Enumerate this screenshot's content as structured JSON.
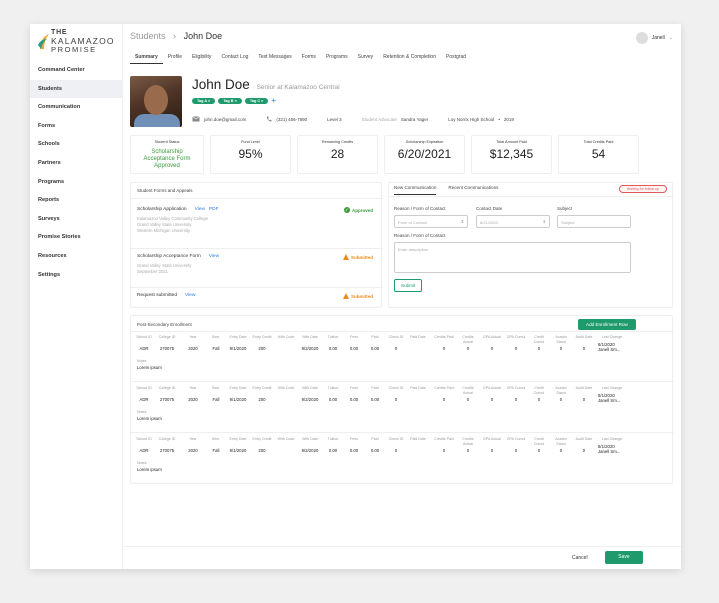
{
  "logo": {
    "line1": "THE",
    "line2": "KALAMAZOO",
    "line3": "PROMISE"
  },
  "sidebar": {
    "items": [
      {
        "label": "Command Center"
      },
      {
        "label": "Students"
      },
      {
        "label": "Communication"
      },
      {
        "label": "Forms"
      },
      {
        "label": "Schools"
      },
      {
        "label": "Partners"
      },
      {
        "label": "Programs"
      },
      {
        "label": "Reports"
      },
      {
        "label": "Surveys"
      },
      {
        "label": "Promise Stories"
      },
      {
        "label": "Resources"
      },
      {
        "label": "Settings"
      }
    ],
    "active": "Students"
  },
  "header": {
    "section": "Students",
    "separator": "›",
    "student": "John Doe",
    "user": "Janell"
  },
  "tabs": [
    "Summary",
    "Profile",
    "Eligibility",
    "Contact Log",
    "Text Messages",
    "Forms",
    "Programs",
    "Survey",
    "Retention & Completion",
    "Postgrad"
  ],
  "student": {
    "name": "John Doe",
    "subtitle": "Senior at Kalamazoo Central",
    "tags": [
      "Tag A",
      "Tag B",
      "Tag C"
    ],
    "email": "john.doe@gmail.com",
    "phone": "(321) 456-7890",
    "level": "Level 3",
    "advocate_label": "Student Advocate",
    "advocate": "Sandra Yager",
    "school": "Loy Norrix High School",
    "year": "2019"
  },
  "stats": {
    "status_label": "Student Status",
    "status_value": "Scholarship Acceptance Form Approved",
    "fund_label": "Fund Level",
    "fund_value": "95%",
    "credits_label": "Remaining Credits",
    "credits_value": "28",
    "expiration_label": "Scholarship Expiration",
    "expiration_value": "6/20/2021",
    "paid_label": "Total Amount Paid",
    "paid_value": "$12,345",
    "tcp_label": "Total Credits Paid",
    "tcp_value": "54"
  },
  "forms": {
    "title": "Student Forms and Appeals",
    "items": [
      {
        "name": "Scholarship Application",
        "view": "View",
        "pdf": "PDF",
        "status": "Approved",
        "sub": [
          "Kalamazoo Valley Community College",
          "Grand Valley State University",
          "Western Michigan University"
        ]
      },
      {
        "name": "Scholarship Acceptance Form",
        "view": "View",
        "status": "Submitted",
        "sub": [
          "Grand Valley State University",
          "September 2021"
        ]
      },
      {
        "name": "Request submitted",
        "view": "View",
        "status": "Submitted"
      }
    ]
  },
  "communication": {
    "tab_new": "New Communication",
    "tab_recent": "Recent Communications",
    "badge": "Waiting for follow up",
    "reason_label": "Reason / Form of Contact",
    "reason_placeholder": "Form of Contact",
    "date_label": "Contact Date",
    "date_value": "6/21/2020",
    "subject_label": "Subject",
    "subject_placeholder": "Subject",
    "desc_label": "Reason / Form of Contact",
    "desc_placeholder": "Enter description",
    "submit": "Submit"
  },
  "enrollment": {
    "title": "Post-Secondary Enrollment",
    "add_button": "Add Enrollment Row",
    "headers": [
      "School ID",
      "College ID",
      "Year",
      "Sem.",
      "Entry Date",
      "Entry Credit",
      "With Code",
      "With Date",
      "Tuition",
      "Fees",
      "Paid",
      "Check ID",
      "Paid Date",
      "Credits Paid",
      "Credits Actual",
      "GPA Actual",
      "GPA Cumul",
      "Credit Cumul",
      "Acadm Stand",
      "Audit Date",
      "Last Change"
    ],
    "rows": [
      {
        "values": [
          "ADR",
          "270075",
          "2020",
          "Fall",
          "9/1/2020",
          "200",
          "",
          "9/2/2020",
          "0.00",
          "0.00",
          "0.00",
          "0",
          "",
          "0",
          "0",
          "0",
          "0",
          "0",
          "0",
          "0",
          "8/1/2020 Janell Sm..."
        ],
        "notes_label": "Notes",
        "notes": "Lorem ipsum"
      },
      {
        "values": [
          "ADR",
          "270075",
          "2020",
          "Fall",
          "9/1/2020",
          "200",
          "",
          "9/2/2020",
          "0.00",
          "0.00",
          "0.00",
          "0",
          "",
          "0",
          "0",
          "0",
          "0",
          "0",
          "0",
          "0",
          "8/1/2020 Janell Sm..."
        ],
        "notes_label": "Notes",
        "notes": "Lorem ipsum"
      },
      {
        "values": [
          "ADR",
          "270075",
          "2020",
          "Fall",
          "9/1/2020",
          "200",
          "",
          "9/2/2020",
          "0.00",
          "0.00",
          "0.00",
          "0",
          "",
          "0",
          "0",
          "0",
          "0",
          "0",
          "0",
          "0",
          "8/1/2020 Janell Sm..."
        ],
        "notes_label": "Notes",
        "notes": "Lorem ipsum"
      }
    ]
  },
  "footer": {
    "cancel": "Cancel",
    "save": "Save"
  },
  "colors": {
    "accent": "#1f9a6c",
    "link": "#2a7ae2",
    "approved": "#3c9a3c",
    "submitted": "#e98a1e",
    "alert": "#e05a5a"
  }
}
